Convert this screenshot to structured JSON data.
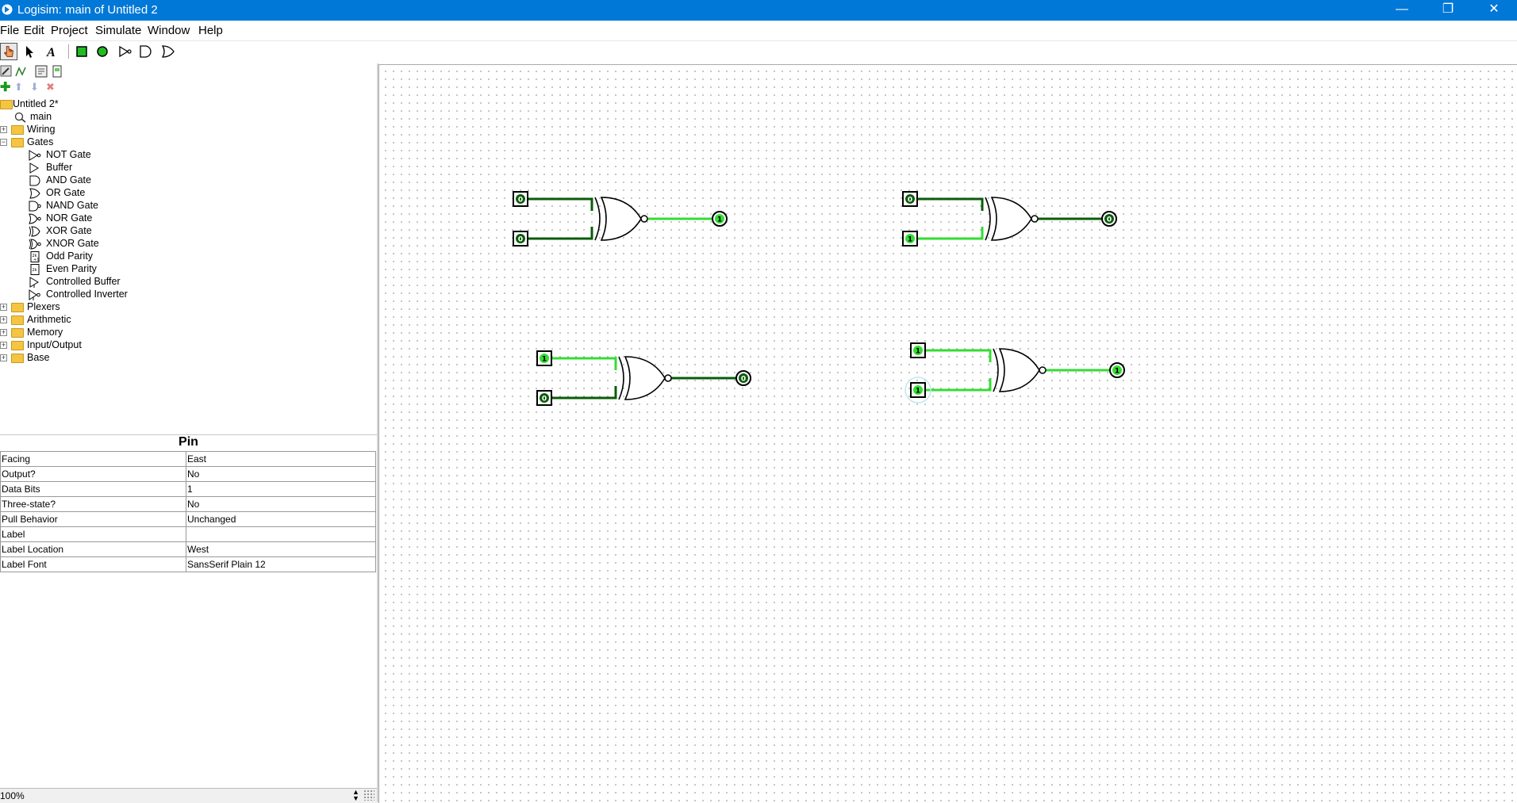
{
  "window": {
    "title": "Logisim: main of Untitled 2",
    "minimize": "—",
    "restore": "❐",
    "close": "✕"
  },
  "menu": [
    "File",
    "Edit",
    "Project",
    "Simulate",
    "Window",
    "Help"
  ],
  "tree": {
    "project": "Untitled 2*",
    "circuit": "main",
    "folders": [
      "Wiring",
      "Gates",
      "Plexers",
      "Arithmetic",
      "Memory",
      "Input/Output",
      "Base"
    ],
    "gates": [
      "NOT Gate",
      "Buffer",
      "AND Gate",
      "OR Gate",
      "NAND Gate",
      "NOR Gate",
      "XOR Gate",
      "XNOR Gate",
      "Odd Parity",
      "Even Parity",
      "Controlled Buffer",
      "Controlled Inverter"
    ]
  },
  "props": {
    "title": "Pin",
    "rows": [
      {
        "k": "Facing",
        "v": "East"
      },
      {
        "k": "Output?",
        "v": "No"
      },
      {
        "k": "Data Bits",
        "v": "1"
      },
      {
        "k": "Three-state?",
        "v": "No"
      },
      {
        "k": "Pull Behavior",
        "v": "Unchanged"
      },
      {
        "k": "Label",
        "v": ""
      },
      {
        "k": "Label Location",
        "v": "West"
      },
      {
        "k": "Label Font",
        "v": "SansSerif Plain 12"
      }
    ]
  },
  "status": {
    "zoom": "100%"
  },
  "circuit": {
    "circuits": [
      {
        "in_a": "0",
        "in_b": "0",
        "out": "1"
      },
      {
        "in_a": "0",
        "in_b": "1",
        "out": "0"
      },
      {
        "in_a": "1",
        "in_b": "0",
        "out": "0"
      },
      {
        "in_a": "1",
        "in_b": "1",
        "out": "1"
      }
    ],
    "colors": {
      "high": "#33dd33",
      "low": "#0a5c0a",
      "pin_one": "#33dd33",
      "pin_zero": "#0a5c0a"
    }
  }
}
